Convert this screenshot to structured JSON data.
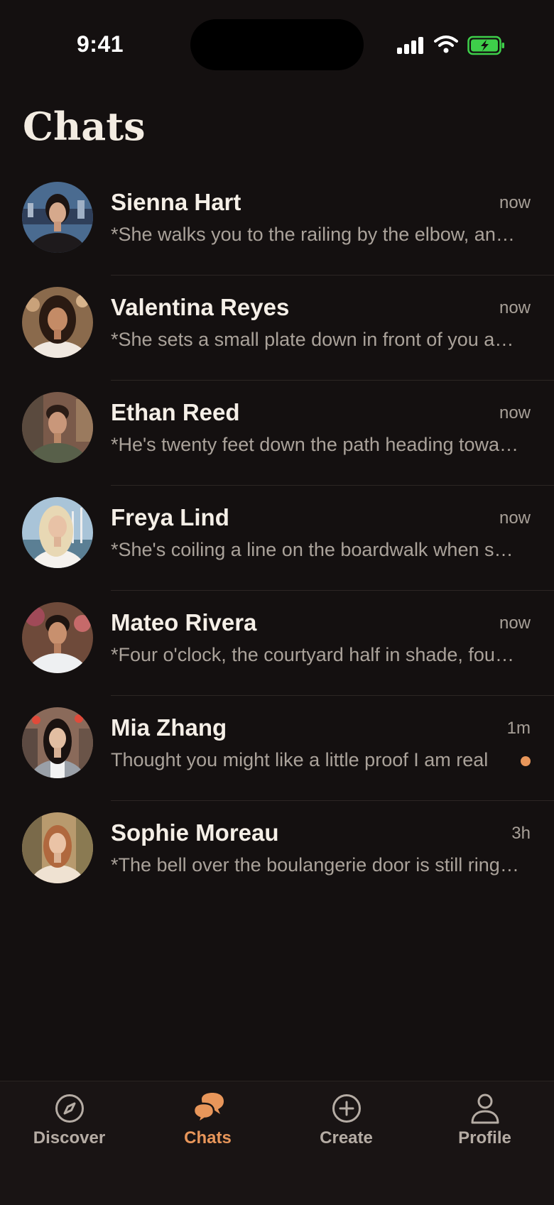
{
  "status_bar": {
    "time": "9:41"
  },
  "header": {
    "title": "Chats"
  },
  "chats": [
    {
      "name": "Sienna Hart",
      "time": "now",
      "preview": "*She walks you to the railing by the elbow, and the night air carries the smell of the river",
      "unread": false
    },
    {
      "name": "Valentina Reyes",
      "time": "now",
      "preview": "*She sets a small plate down in front of you and smiles",
      "unread": false
    },
    {
      "name": "Ethan Reed",
      "time": "now",
      "preview": "*He's twenty feet down the path heading toward the trees",
      "unread": false
    },
    {
      "name": "Freya Lind",
      "time": "now",
      "preview": "*She's coiling a line on the boardwalk when she looks up",
      "unread": false
    },
    {
      "name": "Mateo Rivera",
      "time": "now",
      "preview": "*Four o'clock, the courtyard half in shade, fountain trickling",
      "unread": false
    },
    {
      "name": "Mia Zhang",
      "time": "1m",
      "preview": "Thought you might like a little proof I am real",
      "unread": true
    },
    {
      "name": "Sophie Moreau",
      "time": "3h",
      "preview": "*The bell over the boulangerie door is still ringing",
      "unread": false
    }
  ],
  "tab_bar": {
    "tabs": [
      {
        "label": "Discover",
        "icon": "compass-icon",
        "active": false
      },
      {
        "label": "Chats",
        "icon": "chat-bubbles-icon",
        "active": true
      },
      {
        "label": "Create",
        "icon": "plus-circle-icon",
        "active": false
      },
      {
        "label": "Profile",
        "icon": "person-icon",
        "active": false
      }
    ]
  },
  "colors": {
    "accent": "#e8965a",
    "background": "#141010",
    "battery": "#3ecf4a"
  }
}
